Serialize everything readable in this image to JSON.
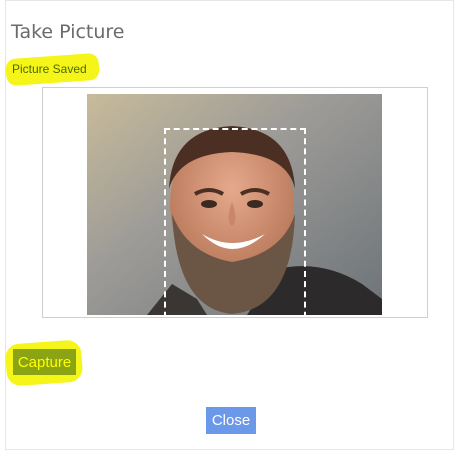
{
  "dialog": {
    "title": "Take Picture",
    "status": "Picture Saved",
    "capture_label": "Capture",
    "close_label": "Close"
  },
  "colors": {
    "highlight": "#f5f51a",
    "capture_button": "#8aa414",
    "close_button": "#6b98e9"
  }
}
